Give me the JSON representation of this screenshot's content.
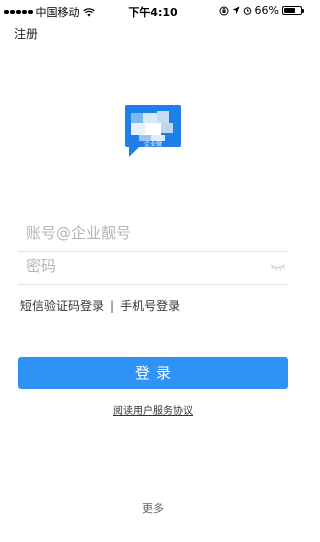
{
  "status_bar": {
    "carrier": "中国移动",
    "time": "下午4:10",
    "battery": "66%",
    "battery_level": 0.66
  },
  "header": {
    "register_label": "注册"
  },
  "logo": {
    "caption": "企业微"
  },
  "form": {
    "account_placeholder": "账号@企业靓号",
    "password_placeholder": "密码"
  },
  "alt_login": {
    "sms_label": "短信验证码登录",
    "separator": "|",
    "phone_label": "手机号登录"
  },
  "login_button_label": "登录",
  "agreement_label": "阅读用户服务协议",
  "more_label": "更多",
  "colors": {
    "primary": "#2f93f5",
    "logo_blue": "#1f7ee8"
  }
}
